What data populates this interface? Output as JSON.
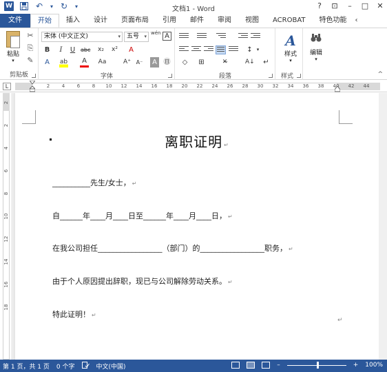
{
  "window": {
    "title": "文档1 - Word",
    "help": "?",
    "ribbon_display": "⊡",
    "minimize": "–",
    "restore": "□",
    "close": "✕"
  },
  "qat": {
    "word_logo": "W",
    "save_icon": "save-icon",
    "undo": "↶",
    "undo_dd": "▾",
    "redo": "↻",
    "customize": "▾"
  },
  "tabs": {
    "file": "文件",
    "home": "开始",
    "insert": "插入",
    "design": "设计",
    "layout": "页面布局",
    "references": "引用",
    "mailings": "邮件",
    "review": "审阅",
    "view": "视图",
    "acrobat": "ACROBAT",
    "special": "特色功能",
    "more": "‹"
  },
  "ribbon": {
    "clipboard": {
      "label": "剪贴板",
      "paste": "粘贴",
      "paste_dd": "▾",
      "cut": "✂",
      "copy": "⎘",
      "format_painter": "✎"
    },
    "font": {
      "label": "字体",
      "name": "宋体 (中文正文)",
      "size": "五号",
      "dd": "▾",
      "grow_font": "A",
      "shrink_font": "A",
      "phonetic": "wén",
      "char_border": "A",
      "bold": "B",
      "italic": "I",
      "underline": "U",
      "strike": "abc",
      "subscript": "x₂",
      "superscript": "x²",
      "clear": "A",
      "effects": "A",
      "highlight": "ab",
      "font_color": "A",
      "change_case": "Aa",
      "grow": "A⁺",
      "shrink": "A⁻",
      "shading": "A",
      "enclose": "㊐"
    },
    "paragraph": {
      "label": "段落",
      "sort": "A↓",
      "show_marks": "↵",
      "line_spacing": "↕",
      "shading": "◇",
      "borders": "⊞",
      "dd": "▾"
    },
    "styles": {
      "label": "样式",
      "button": "样式",
      "glyph": "A"
    },
    "editing": {
      "label": "编辑",
      "button": "编辑",
      "glyph": "🔍"
    },
    "collapse": "^"
  },
  "ruler": {
    "corner": "L",
    "numbers": [
      "2",
      "4",
      "6",
      "8",
      "10",
      "12",
      "14",
      "16",
      "18",
      "20",
      "22",
      "24",
      "26",
      "28",
      "30",
      "32",
      "34",
      "36",
      "38",
      "40",
      "42",
      "44"
    ],
    "v_numbers": [
      "2",
      "2",
      "4",
      "6",
      "8",
      "10",
      "12",
      "14",
      "16",
      "18"
    ]
  },
  "document": {
    "title": "离职证明",
    "line1": "__________先生/女士，",
    "line2": "自______年____月____日至______年____月____日，",
    "line3": "在我公司担任_________________（部门）的_________________职务，",
    "line4": "由于个人原因提出辞职，现已与公司解除劳动关系。",
    "line5": "特此证明！",
    "para_mark": "↵"
  },
  "statusbar": {
    "page": "第 1 页，共 1 页",
    "words": "0 个字",
    "proof_icon": "proofing-icon",
    "language": "中文(中国)",
    "zoom_minus": "–",
    "zoom_plus": "+",
    "zoom": "100%",
    "zoom_level": 1.0
  },
  "colors": {
    "accent": "#2b579a",
    "status_bg": "#2b579a"
  }
}
